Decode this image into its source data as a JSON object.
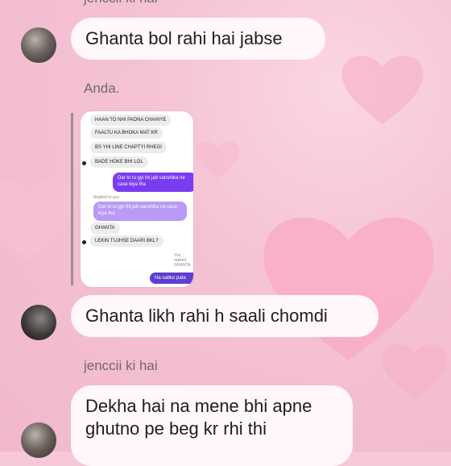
{
  "top_label": "jenccii ki hai",
  "messages": {
    "m1": "Ghanta bol rahi hai jabse",
    "sender_label": "Anda.",
    "m2": "Ghanta likh rahi h saali chomdi",
    "sender_label_2": "jenccii ki hai",
    "m3": "Dekha hai na mene bhi apne ghutno pe beg kr rhi thi"
  },
  "shared_screenshot": {
    "lines": [
      "HAAN TO NHI PADNA CHAHIYE",
      "FAALTU KA BHOKA MAT KR",
      "BS YHI LINE CHAPTYI RHEGI",
      "BADE HOKE BHI LOL",
      "Dar to tu gyi thi jab vanshika ne case kiya tha",
      "Replied to you",
      "Dar to tu gyi thi jab vanshika ne case kiya tha",
      "GHANTA",
      "LEKIN TUJHSE DAARI BKL?",
      "You replied",
      "GHANTA",
      "Ha sabko pata"
    ]
  },
  "colors": {
    "background": "#f6c8d8",
    "bubble": "#fff7fa",
    "sent_purple": "#7a3cf0"
  }
}
